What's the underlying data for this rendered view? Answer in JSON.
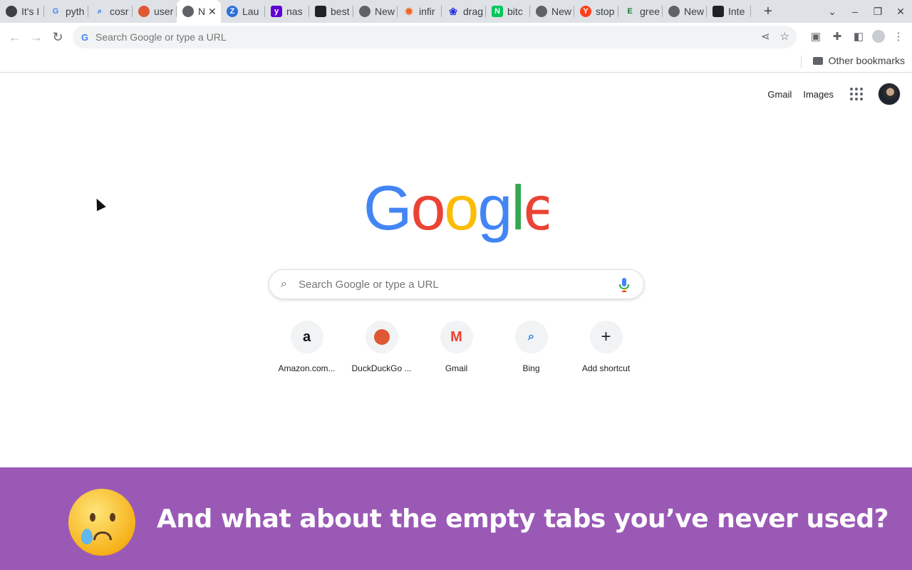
{
  "tabs": [
    {
      "title": "It's I",
      "icon": "circle-icon",
      "color": "#3c4043"
    },
    {
      "title": "pyth",
      "icon": "google-g-icon",
      "color": "#4285f4"
    },
    {
      "title": "cosr",
      "icon": "search-icon",
      "color": "#1a73e8"
    },
    {
      "title": "user",
      "icon": "duckduckgo-icon",
      "color": "#de5833"
    },
    {
      "title": "N",
      "icon": "chrome-icon",
      "color": "#5f6368",
      "active": true
    },
    {
      "title": "Lau",
      "icon": "z-icon",
      "color": "#2d6fdb"
    },
    {
      "title": "nas",
      "icon": "yahoo-icon",
      "color": "#5f01d1"
    },
    {
      "title": "best",
      "icon": "page-icon",
      "color": "#202124"
    },
    {
      "title": "New",
      "icon": "chrome-icon",
      "color": "#5f6368"
    },
    {
      "title": "infir",
      "icon": "gear-icon",
      "color": "#f26522"
    },
    {
      "title": "drag",
      "icon": "paw-icon",
      "color": "#2932e1"
    },
    {
      "title": "bitc",
      "icon": "n-icon",
      "color": "#03c75a"
    },
    {
      "title": "New",
      "icon": "chrome-icon",
      "color": "#5f6368"
    },
    {
      "title": "stop",
      "icon": "yandex-icon",
      "color": "#fc3f1d"
    },
    {
      "title": "gree",
      "icon": "e-icon",
      "color": "#1a7f37"
    },
    {
      "title": "New",
      "icon": "chrome-icon",
      "color": "#5f6368"
    },
    {
      "title": "Inte",
      "icon": "archive-icon",
      "color": "#202124"
    }
  ],
  "omnibox": {
    "placeholder": "Search Google or type a URL"
  },
  "bookmarks": {
    "other": "Other bookmarks"
  },
  "ntp": {
    "gmail_link": "Gmail",
    "images_link": "Images",
    "logo_text": "Google",
    "search_placeholder": "Search Google or type a URL",
    "shortcuts": [
      {
        "label": "Amazon.com...",
        "icon": "amazon-icon"
      },
      {
        "label": "DuckDuckGo ...",
        "icon": "duckduckgo-icon"
      },
      {
        "label": "Gmail",
        "icon": "gmail-icon"
      },
      {
        "label": "Bing",
        "icon": "search-icon"
      },
      {
        "label": "Add shortcut",
        "icon": "plus-icon"
      }
    ]
  },
  "banner": {
    "text": "And what about the empty tabs you’ve never used?",
    "color": "#9b59b6",
    "emoji": "crying-face-icon"
  }
}
